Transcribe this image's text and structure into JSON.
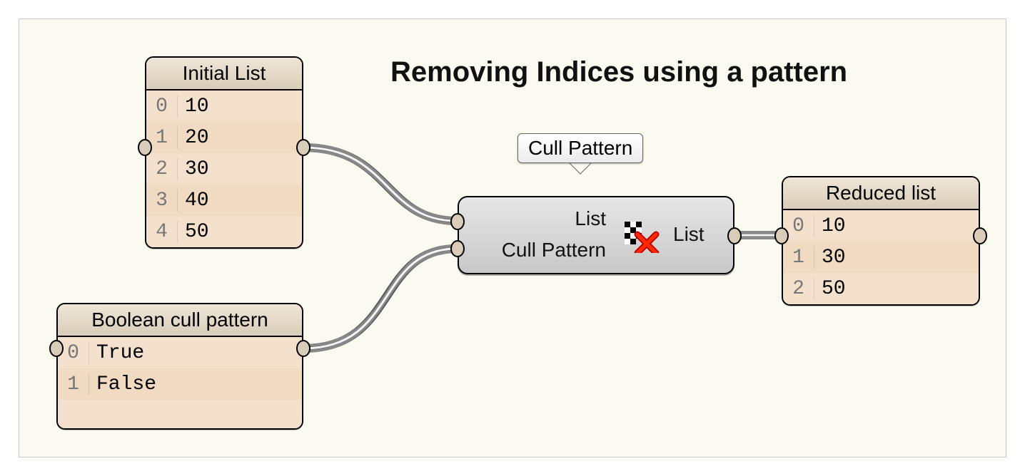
{
  "title": "Removing Indices using a pattern",
  "panels": {
    "initial": {
      "title": "Initial List",
      "rows": [
        {
          "idx": "0",
          "val": "10"
        },
        {
          "idx": "1",
          "val": "20"
        },
        {
          "idx": "2",
          "val": "30"
        },
        {
          "idx": "3",
          "val": "40"
        },
        {
          "idx": "4",
          "val": "50"
        }
      ]
    },
    "pattern": {
      "title": "Boolean cull pattern",
      "rows": [
        {
          "idx": "0",
          "val": "True"
        },
        {
          "idx": "1",
          "val": "False"
        }
      ]
    },
    "reduced": {
      "title": "Reduced list",
      "rows": [
        {
          "idx": "0",
          "val": "10"
        },
        {
          "idx": "1",
          "val": "30"
        },
        {
          "idx": "2",
          "val": "50"
        }
      ]
    }
  },
  "node": {
    "tooltip": "Cull Pattern",
    "input_list": "List",
    "input_pattern": "Cull Pattern",
    "output": "List"
  }
}
